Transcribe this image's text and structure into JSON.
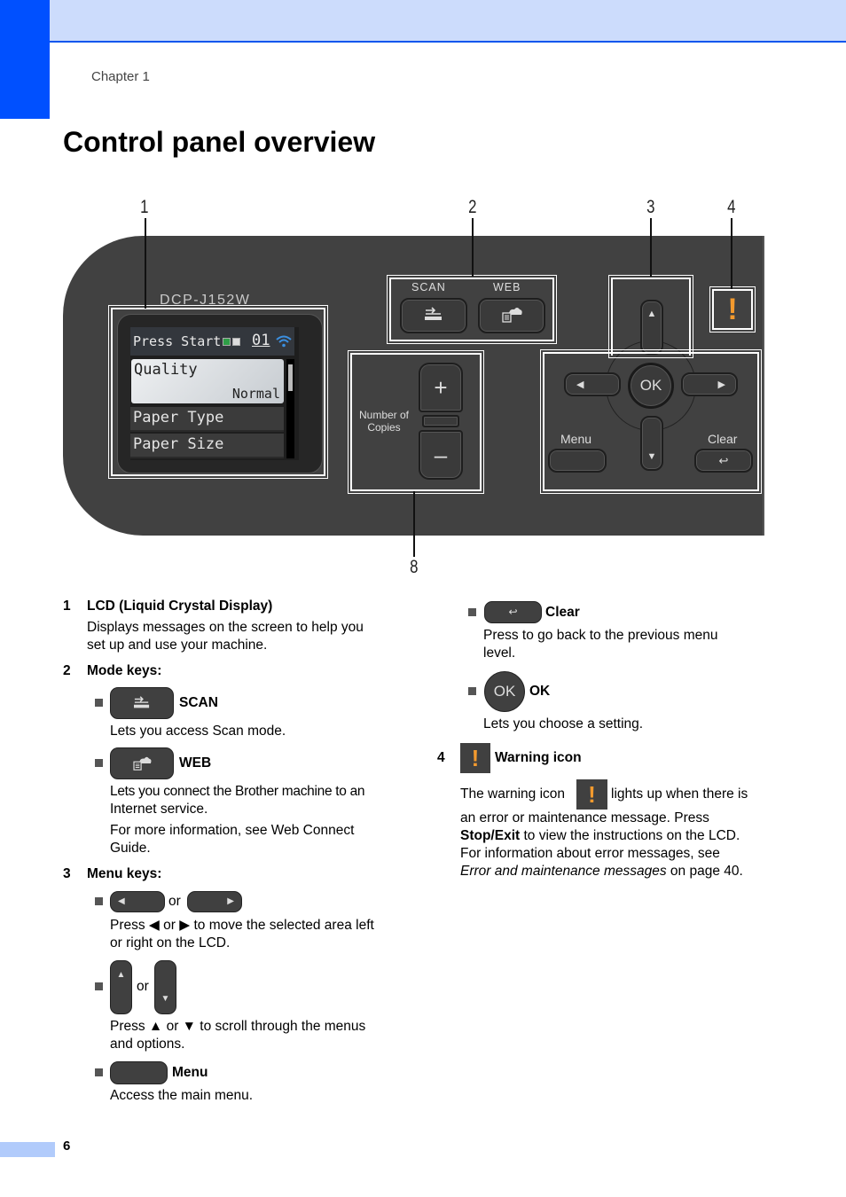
{
  "header": {
    "chapter": "Chapter 1",
    "title": "Control panel overview"
  },
  "figure": {
    "callouts": [
      "1",
      "2",
      "3",
      "4",
      "8"
    ],
    "model": "DCP-J152W",
    "lcd": {
      "status_text": "Press Start",
      "copies": "01",
      "selected_item": "Quality",
      "selected_value": "Normal",
      "items": [
        "Paper Type",
        "Paper Size"
      ]
    },
    "mode_keys": {
      "scan_label": "SCAN",
      "web_label": "WEB"
    },
    "copies_label_1": "Number of",
    "copies_label_2": "Copies",
    "plus": "+",
    "minus": "–",
    "ok": "OK",
    "menu_label": "Menu",
    "clear_label": "Clear",
    "up": "▲",
    "down": "▼",
    "left": "◀",
    "right": "▶",
    "back": "↩",
    "warning": "!"
  },
  "left_col": {
    "s1_num": "1",
    "s1_title": "LCD (Liquid Crystal Display)",
    "s1_text_1": "Displays messages on the screen to help you",
    "s1_text_2": "set up and use your machine.",
    "s2_num": "2",
    "s2_title": "Mode keys:",
    "scan_name": "SCAN",
    "scan_text": "Lets you access Scan mode.",
    "web_name": "WEB",
    "web_text_1": "Lets you connect the Brother machine to an",
    "web_text_2": "Internet service.",
    "web_text_3": "For more information, see Web Connect",
    "web_text_4": "Guide.",
    "s3_num": "3",
    "s3_title": "Menu keys:",
    "or": "or",
    "lr_text_1": "Press ◀ or ▶ to move the selected area left",
    "lr_text_2": "or right on the LCD.",
    "ud_text_1": "Press ▲ or ▼ to scroll through the menus",
    "ud_text_2": "and options.",
    "menu_name": "Menu",
    "menu_text": "Access the main menu."
  },
  "right_col": {
    "clear_name": "Clear",
    "clear_text_1": "Press to go back to the previous menu",
    "clear_text_2": "level.",
    "ok_name": "OK",
    "ok_text": "Lets you choose a setting.",
    "s4_num": "4",
    "s4_title": "Warning icon",
    "warn_text_1a": "The warning icon",
    "warn_text_1b": "lights up when there is",
    "warn_text_2": "an error or maintenance message. Press",
    "warn_text_3_bold": "Stop/Exit",
    "warn_text_3": " to view the instructions on the LCD.",
    "warn_text_4": "For information about error messages, see",
    "warn_text_5_italic": "Error and maintenance messages",
    "warn_text_5": " on page 40."
  },
  "footer": {
    "page_number": "6"
  }
}
